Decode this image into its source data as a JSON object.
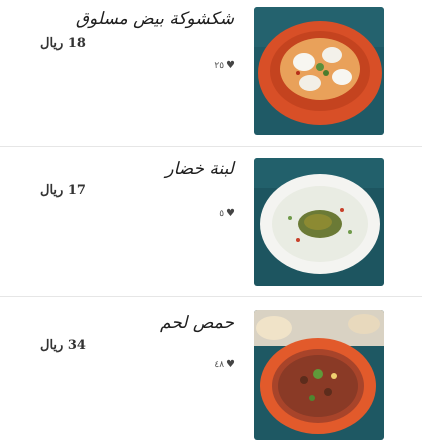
{
  "menu": {
    "items": [
      {
        "name": "شكشوكة بيض مسلوق",
        "price": "18 ريال",
        "likes": "٢٥"
      },
      {
        "name": "لبنة خضار",
        "price": "17 ريال",
        "likes": "٥"
      },
      {
        "name": "حمص لحم",
        "price": "34 ريال",
        "likes": "٤٨"
      }
    ]
  },
  "colors": {
    "background": "#ffffff",
    "divider": "#e6e6e6",
    "photo_backdrop": "#1f5a66",
    "bowl_orange": "#e2562a"
  },
  "icons": {
    "like": "heart-icon"
  }
}
